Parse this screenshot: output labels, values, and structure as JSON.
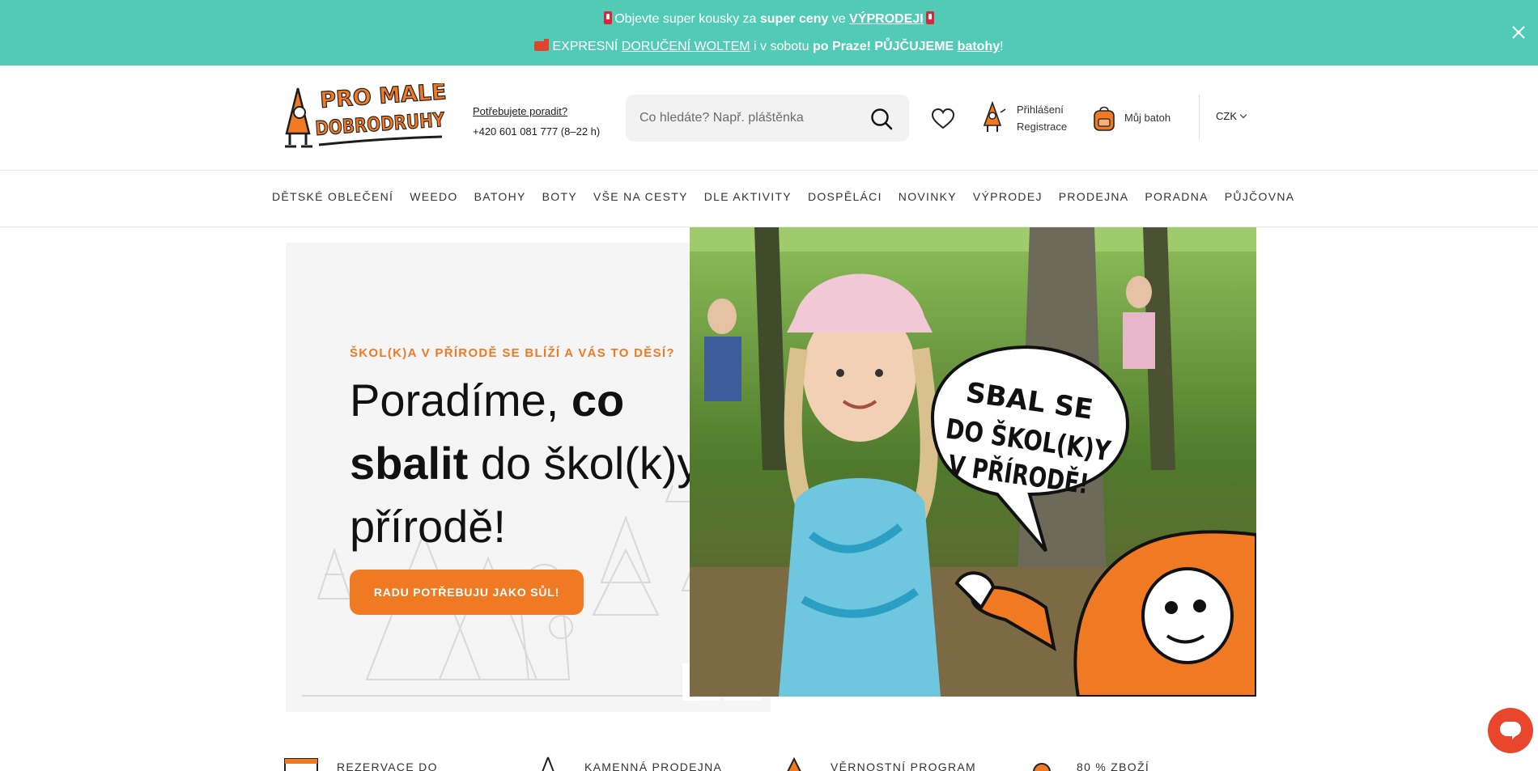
{
  "announcement": {
    "line1": {
      "pre": "Objevte super kousky za ",
      "bold": "super ceny",
      "mid": " ve ",
      "link": "VÝPRODEJI"
    },
    "line2": {
      "pre": "EXPRESNÍ ",
      "link1": "DORUČENÍ WOLTEM",
      "mid": " i v sobotu ",
      "bold1": "po Praze! PŮJČUJEME",
      "space": " ",
      "link2": "batohy",
      "end": "!"
    },
    "close_icon": "close-icon"
  },
  "header": {
    "logo_line1": "PRO MALÉ",
    "logo_line2": "DOBRODRUHY",
    "advice_question": "Potřebujete poradit?",
    "advice_phone": "+420 601 081 777 (8–22 h)",
    "search_placeholder": "Co hledáte? Např. pláštěnka",
    "login": "Přihlášení",
    "register": "Registrace",
    "bag": "Můj batoh",
    "currency": "CZK"
  },
  "nav": {
    "items": [
      "DĚTSKÉ OBLEČENÍ",
      "WEEDO",
      "BATOHY",
      "BOTY",
      "VŠE NA CESTY",
      "DLE AKTIVITY",
      "DOSPĚLÁCI",
      "NOVINKY",
      "VÝPRODEJ",
      "PRODEJNA",
      "PORADNA",
      "PŮJČOVNA"
    ]
  },
  "hero": {
    "kicker": "ŠKOL(K)A V PŘÍRODĚ SE BLÍŽÍ A VÁS TO DĚSÍ?",
    "title_part1": "Poradíme, ",
    "title_bold1": "co sbalit",
    "title_part2": " do škol(k)y v přírodě!",
    "cta": "RADU POTŘEBUJU JAKO SŮL!",
    "bubble_line1": "SBAL SE",
    "bubble_line2": "DO ŠKOL(K)Y",
    "bubble_line3": "V PŘÍRODĚ!"
  },
  "features": {
    "items": [
      "REZERVACE DO",
      "KAMENNÁ PRODEJNA",
      "VĚRNOSTNÍ PROGRAM",
      "80 % ZBOŽÍ"
    ]
  },
  "colors": {
    "accent": "#ef7a23",
    "topbar": "#52cbb6",
    "chat": "#e8462d"
  }
}
